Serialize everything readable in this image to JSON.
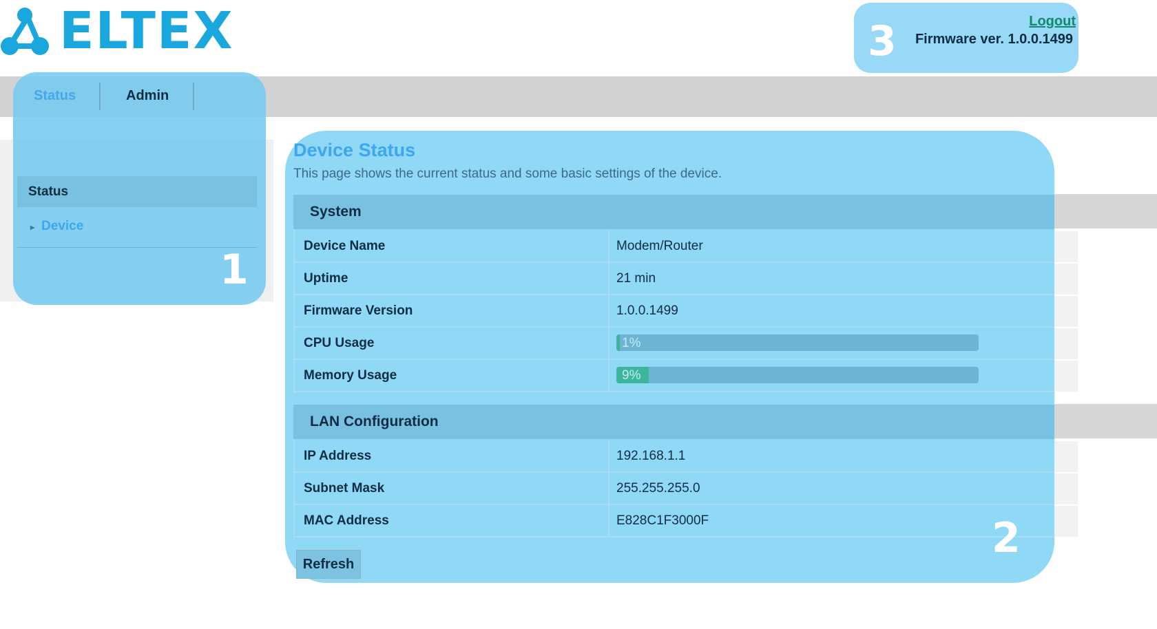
{
  "brand": {
    "logo_text": "ELTEX",
    "color": "#1aa7dd"
  },
  "header": {
    "logout_label": "Logout",
    "firmware_label": "Firmware ver. 1.0.0.1499"
  },
  "nav": {
    "tabs": [
      {
        "label": "Status",
        "active": true
      },
      {
        "label": "Admin",
        "active": false
      }
    ]
  },
  "sidebar": {
    "section_title": "Status",
    "items": [
      {
        "label": "Device",
        "icon": "chevron-right-icon"
      }
    ]
  },
  "main": {
    "title": "Device Status",
    "subtitle": "This page shows the current status and some basic settings of the device.",
    "system": {
      "heading": "System",
      "rows": [
        {
          "label": "Device Name",
          "value": "Modem/Router"
        },
        {
          "label": "Uptime",
          "value": "21 min"
        },
        {
          "label": "Firmware Version",
          "value": "1.0.0.1499"
        }
      ],
      "cpu": {
        "label": "CPU Usage",
        "text": "1%",
        "percent": 1
      },
      "memory": {
        "label": "Memory Usage",
        "text": "9%",
        "percent": 9
      }
    },
    "lan": {
      "heading": "LAN Configuration",
      "rows": [
        {
          "label": "IP Address",
          "value": "192.168.1.1"
        },
        {
          "label": "Subnet Mask",
          "value": "255.255.255.0"
        },
        {
          "label": "MAC Address",
          "value": "E828C1F3000F"
        }
      ]
    },
    "refresh_label": "Refresh"
  },
  "callouts": {
    "one": "1",
    "two": "2",
    "three": "3"
  },
  "colors": {
    "accent": "#3ea6ee",
    "overlay": "#97d9f6",
    "bar_fill": "#3db59a",
    "logout": "#0e8a6b"
  }
}
